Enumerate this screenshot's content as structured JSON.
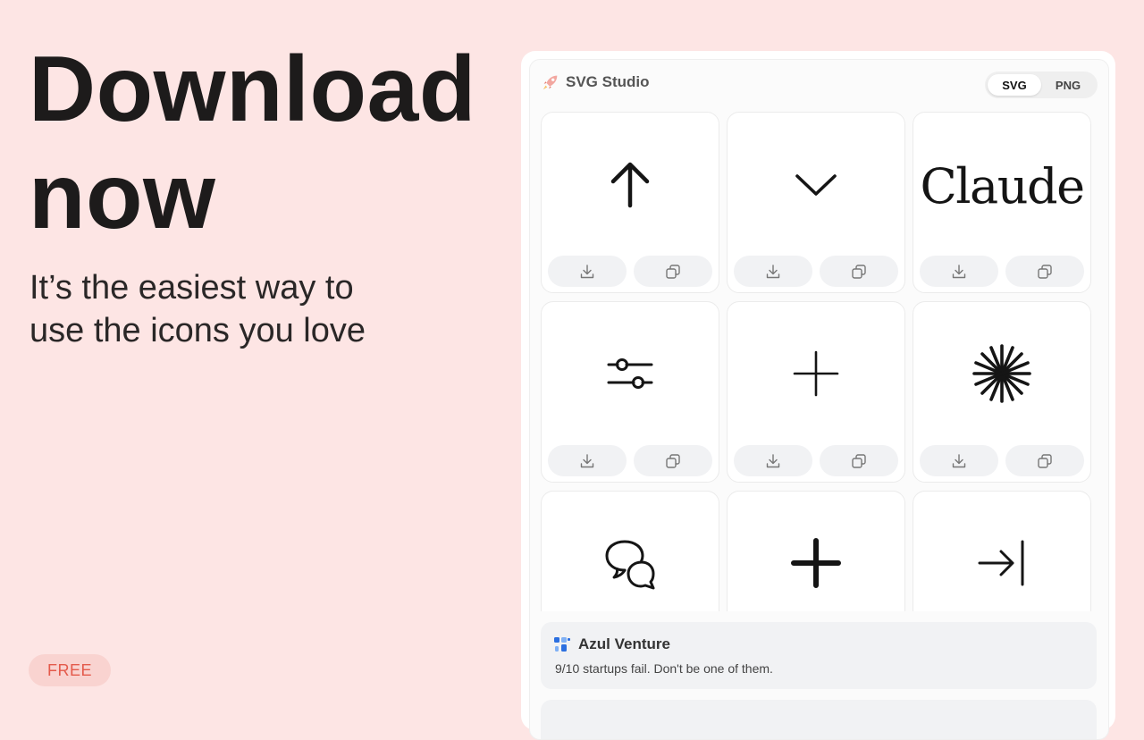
{
  "hero": {
    "headline_line1": "Download",
    "headline_line2": "now",
    "subtitle_line1": "It’s the easiest way to",
    "subtitle_line2": "use the icons you love",
    "badge": "FREE"
  },
  "app": {
    "title": "SVG Studio",
    "formats": [
      "SVG",
      "PNG"
    ],
    "selected_format": "SVG"
  },
  "icons": [
    {
      "name": "arrow-up-icon"
    },
    {
      "name": "chevron-down-icon"
    },
    {
      "name": "claude-wordmark",
      "text": "Claude"
    },
    {
      "name": "sliders-icon"
    },
    {
      "name": "plus-thin-icon"
    },
    {
      "name": "asterisk-burst-icon"
    },
    {
      "name": "chat-bubbles-icon"
    },
    {
      "name": "plus-bold-icon"
    },
    {
      "name": "arrow-right-to-line-icon"
    }
  ],
  "card_actions": [
    "download-icon",
    "copy-icon"
  ],
  "ad": {
    "name": "Azul Venture",
    "text": "9/10 startups fail. Don't be one of them."
  },
  "colors": {
    "background": "#fde5e4",
    "badge_bg": "#f9d3d0",
    "badge_text": "#e45a4b",
    "panel": "#fbfbfb",
    "button_bg": "#f1f2f4"
  }
}
